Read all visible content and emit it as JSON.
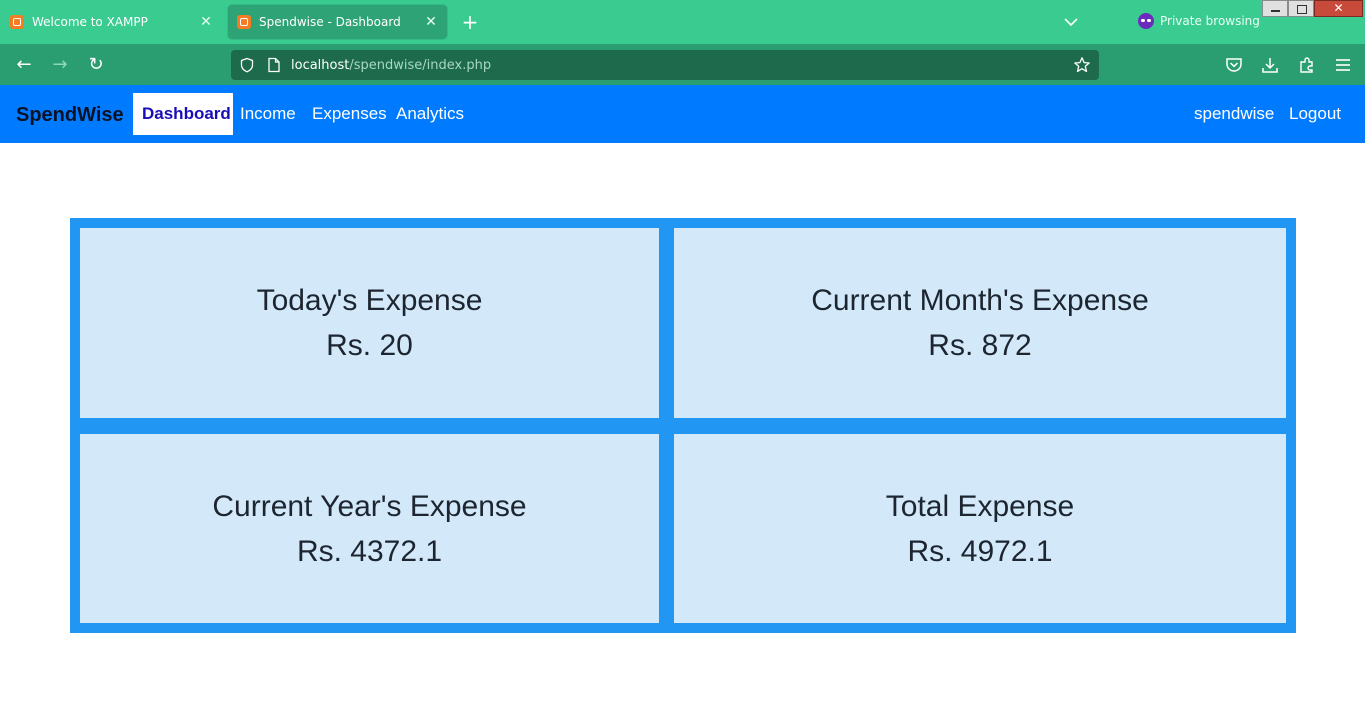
{
  "browser": {
    "tabs": [
      {
        "title": "Welcome to XAMPP",
        "active": false
      },
      {
        "title": "Spendwise - Dashboard",
        "active": true
      }
    ],
    "private_label": "Private browsing",
    "url_host": "localhost",
    "url_path": "/spendwise/index.php",
    "colors": {
      "tabbar": "#39cb90",
      "toolbar": "#2a9e70",
      "urlbar": "#1d6b4c"
    }
  },
  "app": {
    "brand": "SpendWise",
    "nav": {
      "dashboard": "Dashboard",
      "income": "Income",
      "expenses": "Expenses",
      "analytics": "Analytics",
      "user": "spendwise",
      "logout": "Logout"
    },
    "colors": {
      "navbar": "#007bff",
      "grid": "#2196f3",
      "card": "#d3e9fa"
    }
  },
  "dashboard": {
    "cards": [
      {
        "title": "Today's Expense",
        "value": "Rs. 20"
      },
      {
        "title": "Current Month's Expense",
        "value": "Rs. 872"
      },
      {
        "title": "Current Year's Expense",
        "value": "Rs. 4372.1"
      },
      {
        "title": "Total Expense",
        "value": "Rs. 4972.1"
      }
    ]
  }
}
